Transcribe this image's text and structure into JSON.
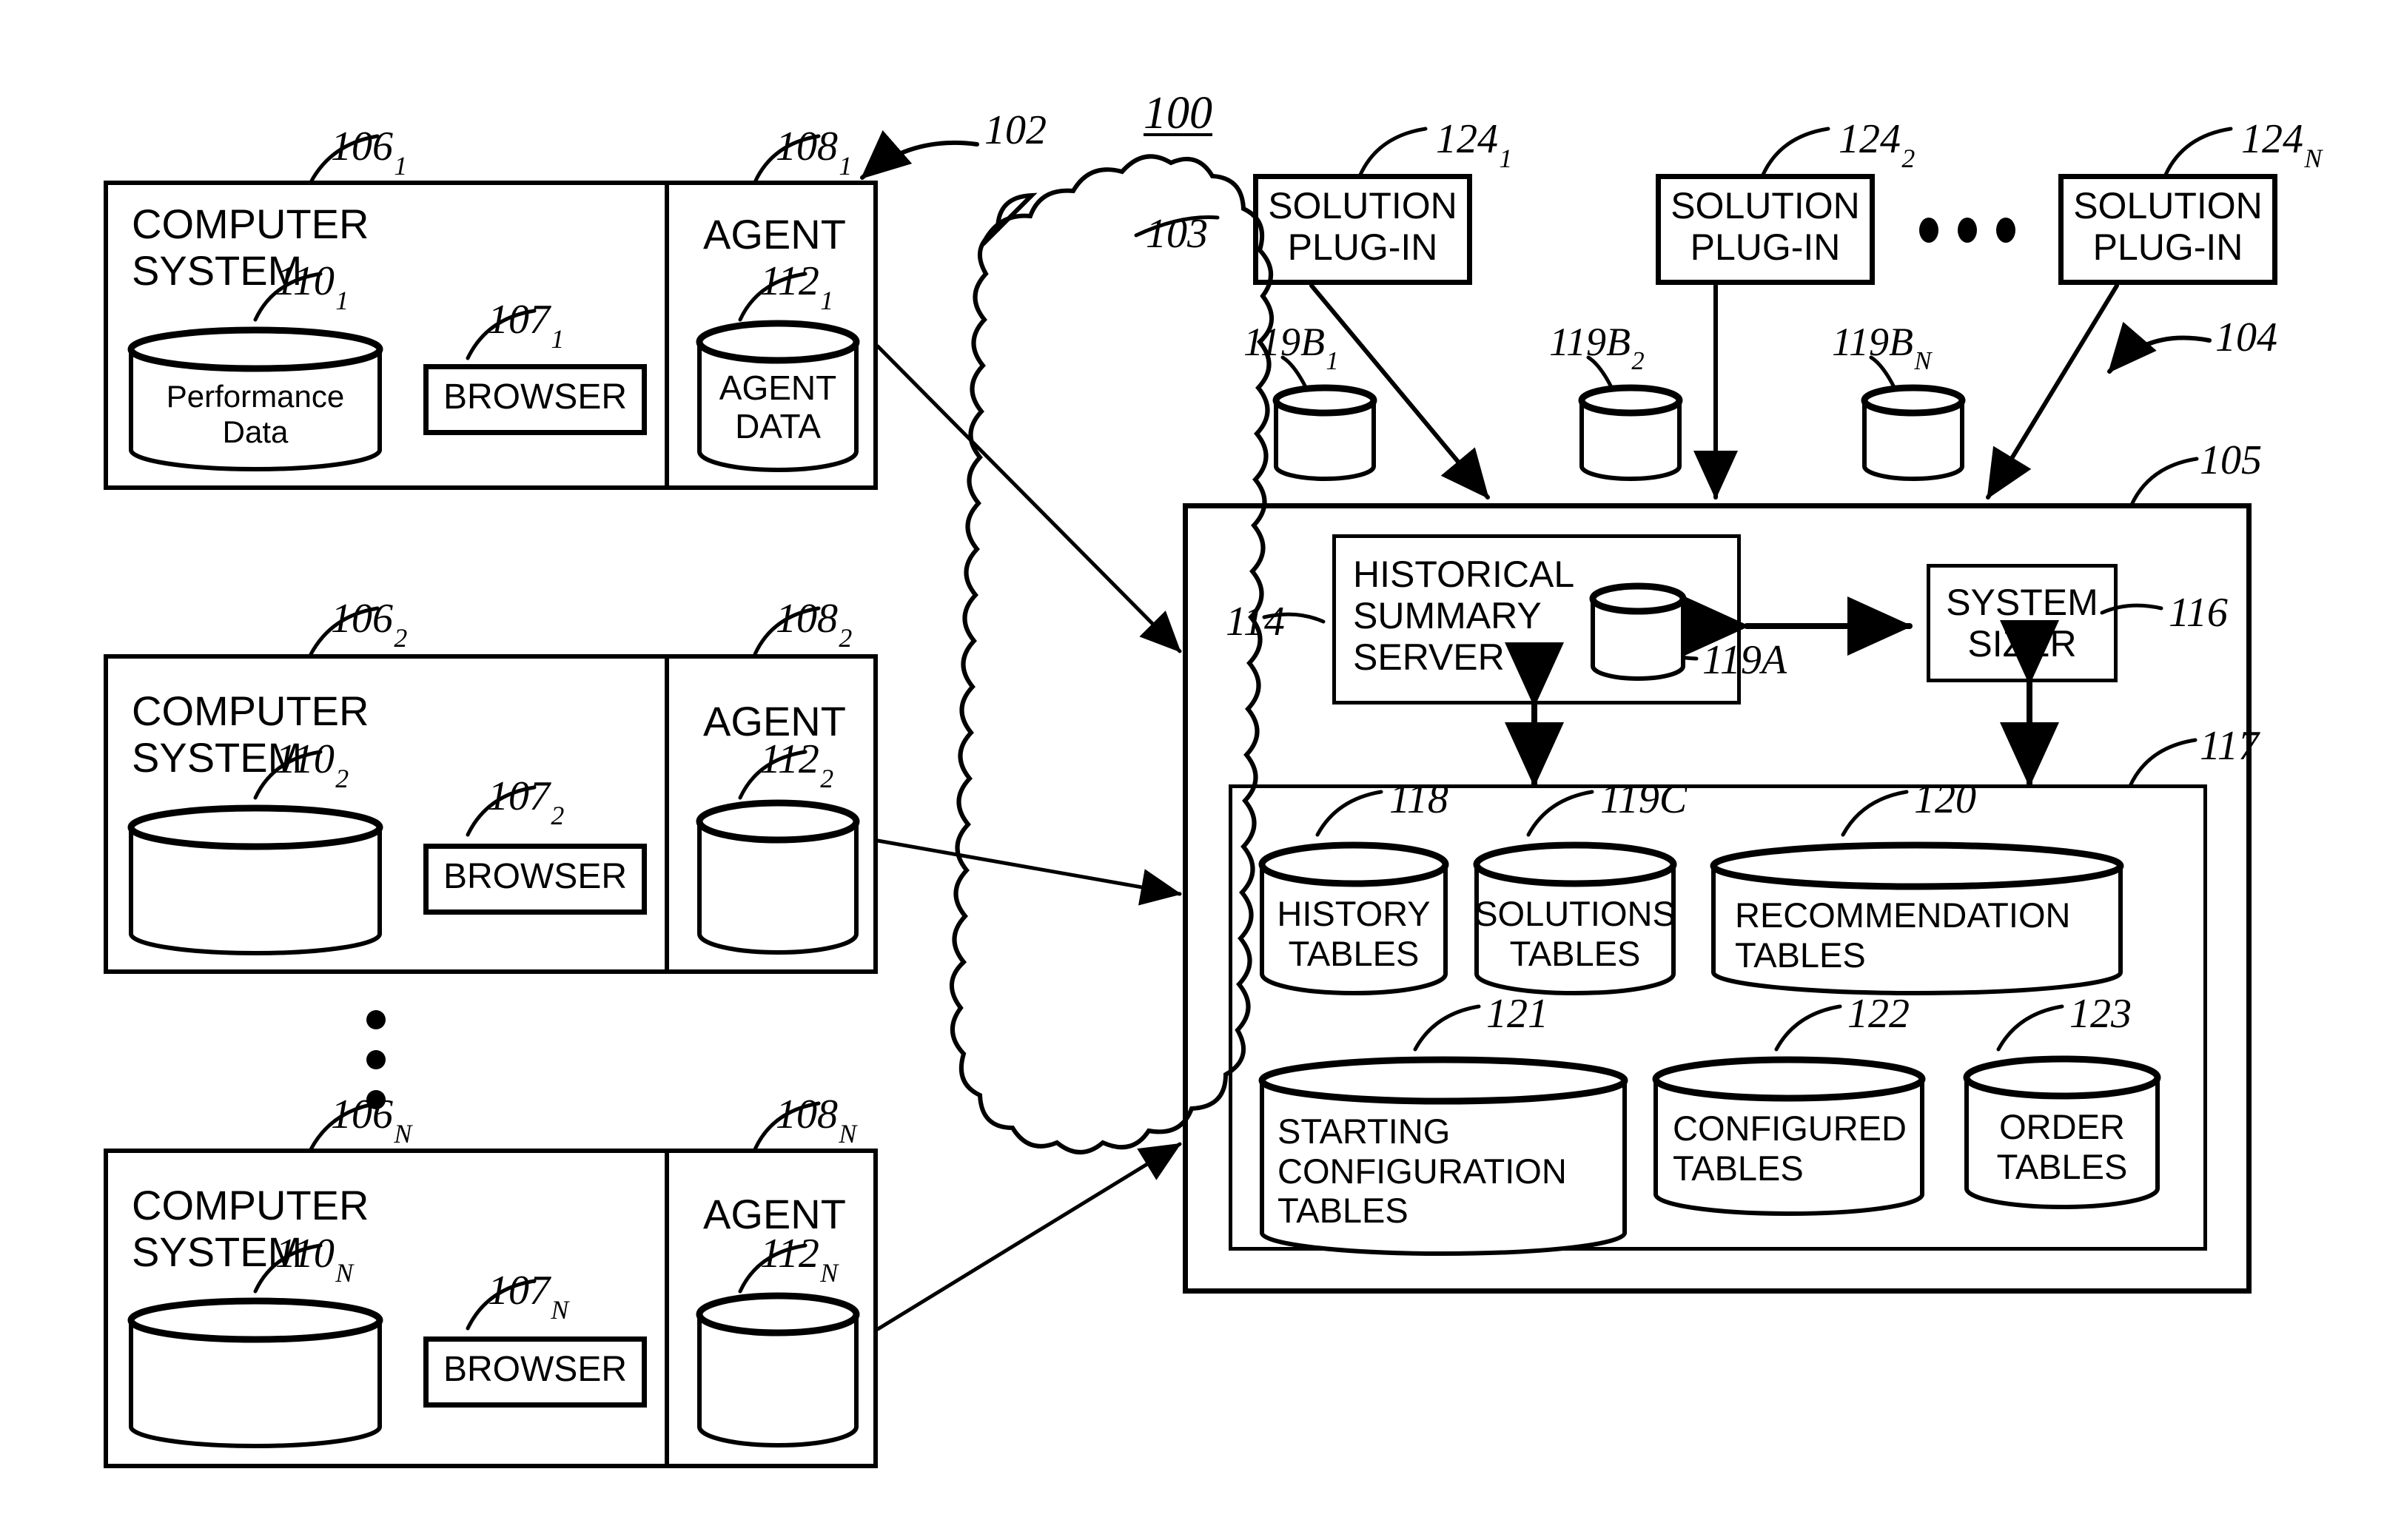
{
  "figure": {
    "number": "100"
  },
  "refs": {
    "network_arrow": "102",
    "cloud": "103",
    "provider_arrow": "104",
    "provider_box": "105",
    "history_summary_server": "114",
    "system_sizer": "116",
    "tables_container": "117",
    "history_tables": "118",
    "hss_db": "119A",
    "solutions_tables": "119C",
    "recommendation_tables": "120",
    "starting_configuration_tables": "121",
    "configured_tables": "122",
    "order_tables": "123"
  },
  "client_side": {
    "systems": [
      {
        "system_ref": "106",
        "system_sub": "1",
        "system_label": "COMPUTER\nSYSTEM",
        "db_ref": "110",
        "db_sub": "1",
        "db_label": "Performance\nData",
        "browser_ref": "107",
        "browser_sub": "1",
        "browser_label": "BROWSER",
        "agent_ref": "108",
        "agent_sub": "1",
        "agent_label": "AGENT",
        "agent_db_ref": "112",
        "agent_db_sub": "1",
        "agent_db_label": "AGENT\nDATA"
      },
      {
        "system_ref": "106",
        "system_sub": "2",
        "system_label": "COMPUTER\nSYSTEM",
        "db_ref": "110",
        "db_sub": "2",
        "db_label": "",
        "browser_ref": "107",
        "browser_sub": "2",
        "browser_label": "BROWSER",
        "agent_ref": "108",
        "agent_sub": "2",
        "agent_label": "AGENT",
        "agent_db_ref": "112",
        "agent_db_sub": "2",
        "agent_db_label": ""
      },
      {
        "system_ref": "106",
        "system_sub": "N",
        "system_label": "COMPUTER\nSYSTEM",
        "db_ref": "110",
        "db_sub": "N",
        "db_label": "",
        "browser_ref": "107",
        "browser_sub": "N",
        "browser_label": "BROWSER",
        "agent_ref": "108",
        "agent_sub": "N",
        "agent_label": "AGENT",
        "agent_db_ref": "112",
        "agent_db_sub": "N",
        "agent_db_label": ""
      }
    ]
  },
  "plugins": [
    {
      "label": "SOLUTION\nPLUG-IN",
      "ref": "124",
      "sub": "1",
      "db_ref": "119B",
      "db_sub": "1"
    },
    {
      "label": "SOLUTION\nPLUG-IN",
      "ref": "124",
      "sub": "2",
      "db_ref": "119B",
      "db_sub": "2"
    },
    {
      "label": "SOLUTION\nPLUG-IN",
      "ref": "124",
      "sub": "N",
      "db_ref": "119B",
      "db_sub": "N"
    }
  ],
  "provider": {
    "history_summary_server_label": "HISTORICAL\nSUMMARY\nSERVER",
    "system_sizer_label": "SYSTEM\nSIZER",
    "tables": [
      {
        "label": "HISTORY\nTABLES",
        "ref": "118"
      },
      {
        "label": "SOLUTIONS\nTABLES",
        "ref": "119C"
      },
      {
        "label": "RECOMMENDATION\nTABLES",
        "ref": "120"
      },
      {
        "label": "STARTING\nCONFIGURATION\nTABLES",
        "ref": "121"
      },
      {
        "label": "CONFIGURED\nTABLES",
        "ref": "122"
      },
      {
        "label": "ORDER\nTABLES",
        "ref": "123"
      }
    ]
  },
  "colors": {
    "ink": "#000000",
    "paper": "#ffffff"
  }
}
